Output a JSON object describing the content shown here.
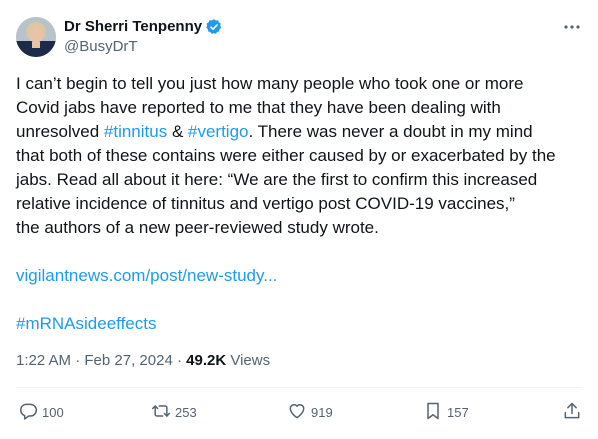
{
  "author": {
    "display_name": "Dr Sherri Tenpenny",
    "handle": "@BusyDrT",
    "verified": true
  },
  "body": {
    "lines": [
      {
        "segments": [
          {
            "text": "I can’t begin to tell you just how many people who took one or more",
            "link": false
          }
        ]
      },
      {
        "segments": [
          {
            "text": "Covid jabs have reported to me that they have been dealing with",
            "link": false
          }
        ]
      },
      {
        "segments": [
          {
            "text": "unresolved ",
            "link": false
          },
          {
            "text": "#tinnitus",
            "link": true
          },
          {
            "text": " & ",
            "link": false
          },
          {
            "text": "#vertigo",
            "link": true
          },
          {
            "text": ". There was never a doubt in my mind",
            "link": false
          }
        ]
      },
      {
        "segments": [
          {
            "text": "that both of these contains were either caused by or exacerbated by the",
            "link": false
          }
        ]
      },
      {
        "segments": [
          {
            "text": "jabs. Read all about it here: “We are the first to confirm this increased",
            "link": false
          }
        ]
      },
      {
        "segments": [
          {
            "text": "relative incidence of tinnitus and vertigo post COVID-19 vaccines,”",
            "link": false
          }
        ]
      },
      {
        "segments": [
          {
            "text": "the authors of a new peer-reviewed study wrote.",
            "link": false
          }
        ]
      }
    ],
    "url_link": "vigilantnews.com/post/new-study...",
    "hashtag_link": "#mRNAsideeffects"
  },
  "meta": {
    "time": "1:22 AM",
    "separator": "·",
    "date": "Feb 27, 2024",
    "views_count": "49.2K",
    "views_label": "Views"
  },
  "actions": {
    "replies": "100",
    "retweets": "253",
    "likes": "919",
    "bookmarks": "157"
  },
  "colors": {
    "link": "#1d9bf0",
    "secondary_text": "#536471",
    "verified_badge": "#1d9bf0"
  },
  "icons": [
    "verified-badge-icon",
    "more-options-icon",
    "reply-icon",
    "retweet-icon",
    "like-icon",
    "bookmark-icon",
    "share-icon"
  ]
}
